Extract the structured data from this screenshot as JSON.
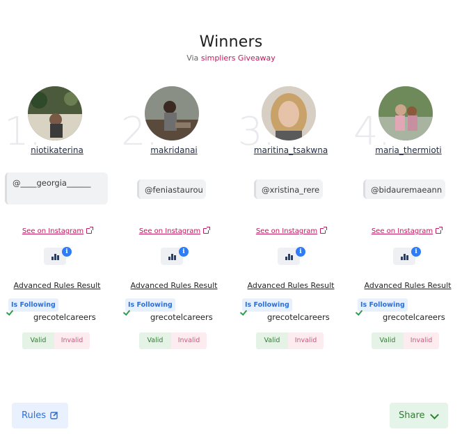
{
  "header": {
    "title": "Winners",
    "subtitle_prefix": "Via",
    "subtitle_brand": "simpliers Giveaway"
  },
  "winners": [
    {
      "rank": "1.",
      "username": "niotikaterina",
      "comment": "@____georgia______",
      "link": "See on Instagram",
      "adv_title": "Advanced Rules Result",
      "badge": "Is Following",
      "account": "grecotelcareers",
      "valid": "Valid",
      "invalid": "Invalid"
    },
    {
      "rank": "2.",
      "username": "makridanai",
      "comment": "@feniastaurou",
      "link": "See on Instagram",
      "adv_title": "Advanced Rules Result",
      "badge": "Is Following",
      "account": "grecotelcareers",
      "valid": "Valid",
      "invalid": "Invalid"
    },
    {
      "rank": "3.",
      "username": "maritina_tsakwna",
      "comment": "@xristina_rere",
      "link": "See on Instagram",
      "adv_title": "Advanced Rules Result",
      "badge": "Is Following",
      "account": "grecotelcareers",
      "valid": "Valid",
      "invalid": "Invalid"
    },
    {
      "rank": "4.",
      "username": "maria_thermioti",
      "comment": "@bidauremaeann",
      "link": "See on Instagram",
      "adv_title": "Advanced Rules Result",
      "badge": "Is Following",
      "account": "grecotelcareers",
      "valid": "Valid",
      "invalid": "Invalid"
    }
  ],
  "footer": {
    "rules_label": "Rules",
    "share_label": "Share"
  },
  "colors": {
    "brand": "#c2185b",
    "blue": "#2f6fd6",
    "green": "#2e7d32"
  }
}
